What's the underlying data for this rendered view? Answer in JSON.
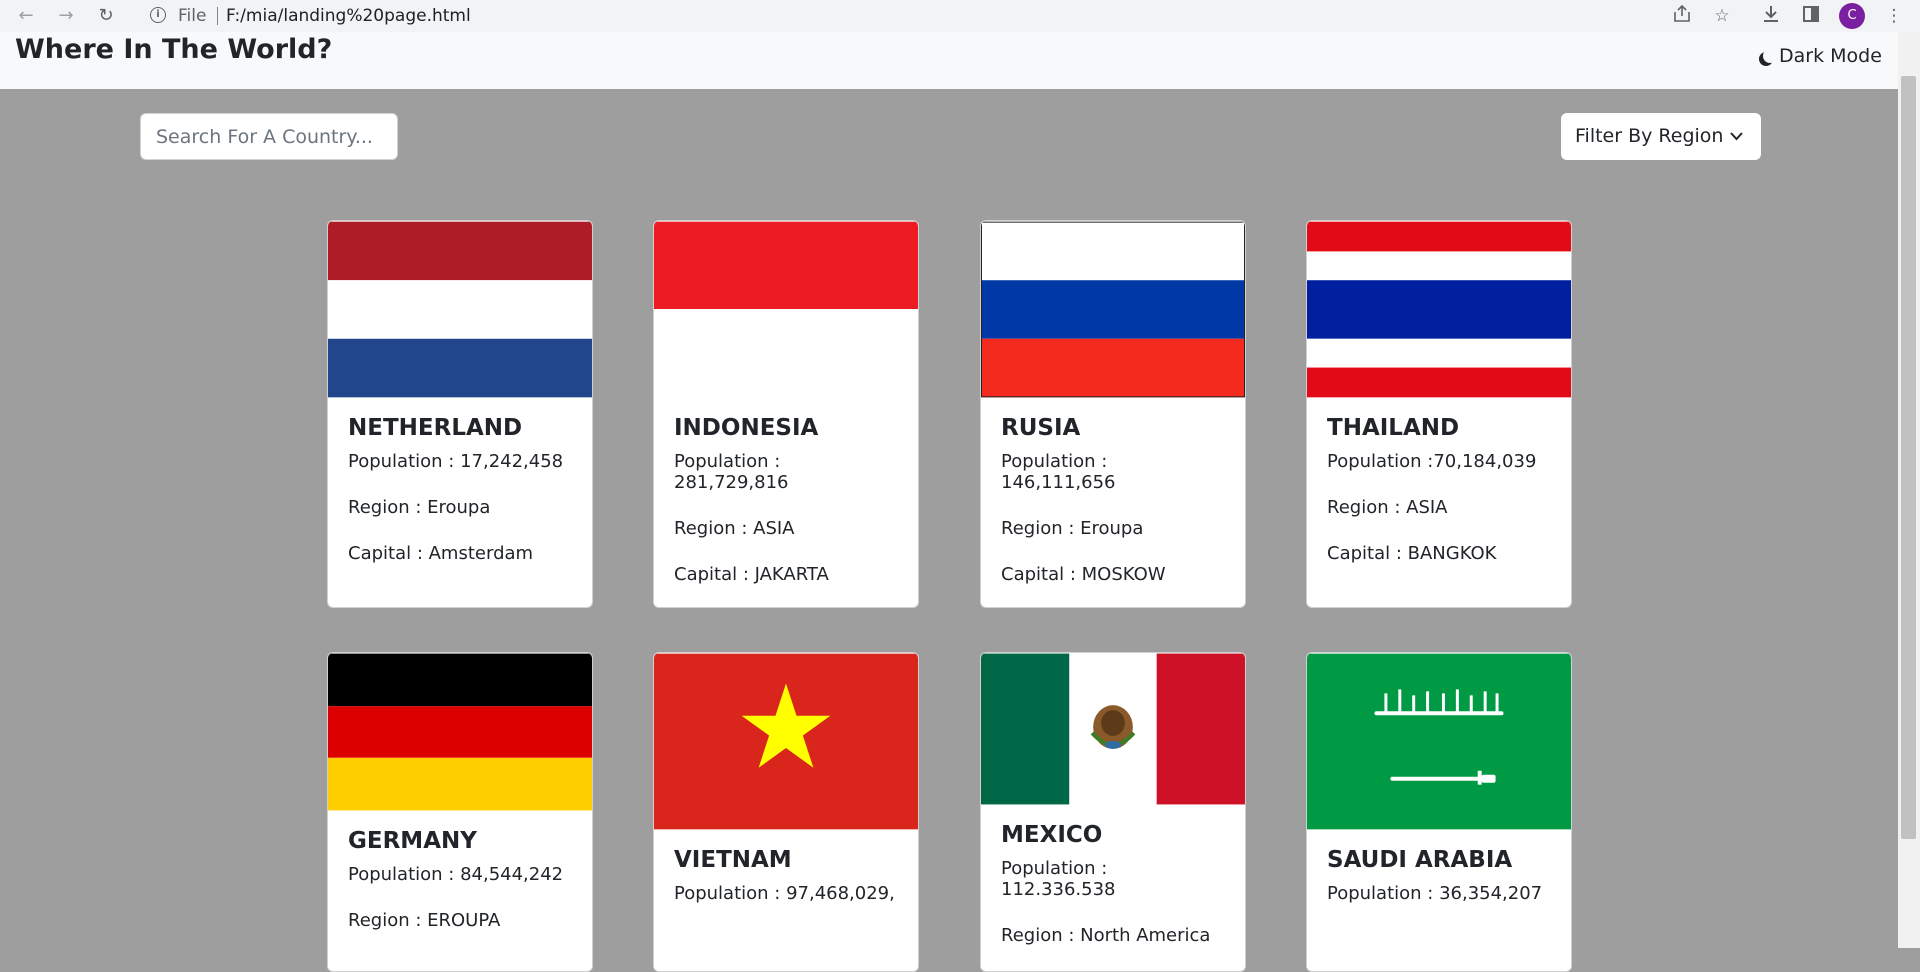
{
  "browser": {
    "url_scheme": "File",
    "url": "F:/mia/landing%20page.html",
    "profile_initial": "C"
  },
  "header": {
    "title": "Where In The World?",
    "dark_mode_label": "Dark Mode"
  },
  "controls": {
    "search_placeholder": "Search For A Country...",
    "filter_label": "Filter By Region"
  },
  "labels": {
    "population": "Population",
    "region": "Region",
    "capital": "Capital"
  },
  "countries": [
    {
      "name": "NETHERLAND",
      "population": "Population : 17,242,458",
      "region": "Region : Eroupa",
      "capital": "Capital : Amsterdam"
    },
    {
      "name": "INDONESIA",
      "population": "Population : 281,729,816",
      "region": "Region : ASIA",
      "capital": "Capital : JAKARTA"
    },
    {
      "name": "RUSIA",
      "population": "Population : 146,111,656",
      "region": "Region : Eroupa",
      "capital": "Capital : MOSKOW"
    },
    {
      "name": "THAILAND",
      "population": "Population :70,184,039",
      "region": "Region : ASIA",
      "capital": "Capital : BANGKOK"
    },
    {
      "name": "GERMANY",
      "population": "Population : 84,544,242",
      "region": "Region : EROUPA",
      "capital": ""
    },
    {
      "name": "VIETNAM",
      "population": "Population : 97,468,029,",
      "region": "",
      "capital": ""
    },
    {
      "name": "MEXICO",
      "population": "Population : 112.336.538",
      "region": "Region : North America",
      "capital": ""
    },
    {
      "name": "SAUDI ARABIA",
      "population": "Population : 36,354,207",
      "region": "",
      "capital": ""
    }
  ],
  "colors": {
    "page_bg": "#9e9e9e",
    "header_bg": "#f8f9fa",
    "netherlands": [
      "#ae1c28",
      "#ffffff",
      "#21468b"
    ],
    "indonesia": [
      "#ed1c24",
      "#ffffff"
    ],
    "russia": [
      "#ffffff",
      "#0039a6",
      "#d52b1e"
    ],
    "thailand": [
      "#e30a17",
      "#ffffff",
      "#00209f"
    ],
    "germany": [
      "#000000",
      "#dd0000",
      "#ffce00"
    ],
    "vietnam": [
      "#da251d",
      "#ffff00"
    ],
    "mexico": [
      "#006847",
      "#ffffff",
      "#ce1126"
    ],
    "saudi": [
      "#009a44",
      "#ffffff"
    ]
  }
}
